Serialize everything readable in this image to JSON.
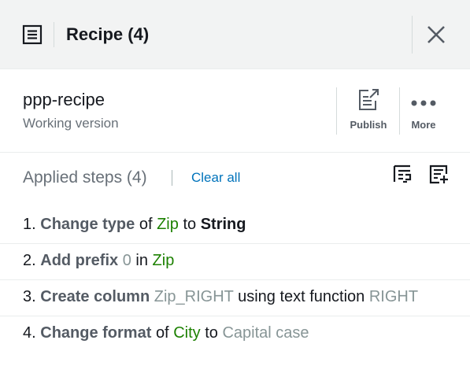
{
  "header": {
    "title": "Recipe (4)"
  },
  "recipe": {
    "name": "ppp-recipe",
    "status": "Working version"
  },
  "actions": {
    "publish_label": "Publish",
    "more_label": "More"
  },
  "steps_section": {
    "title": "Applied steps (4)",
    "clear_label": "Clear all"
  },
  "steps": [
    {
      "num": "1.",
      "action": "Change type",
      "p1": "of",
      "col": "Zip",
      "p2": "to",
      "val": "String"
    },
    {
      "num": "2.",
      "action": "Add prefix",
      "val": "0",
      "p1": "in",
      "col": "Zip"
    },
    {
      "num": "3.",
      "action": "Create column",
      "col": "Zip_RIGHT",
      "p1": "using text function",
      "val": "RIGHT"
    },
    {
      "num": "4.",
      "action": "Change format",
      "p1": "of",
      "col": "City",
      "p2": "to",
      "val": "Capital case"
    }
  ],
  "colors": {
    "accent": "#0073bb",
    "column": "#1d8102",
    "muted": "#687078"
  },
  "icons": [
    "list-icon",
    "close-icon",
    "publish-icon",
    "more-icon",
    "preview-steps-icon",
    "import-steps-icon"
  ]
}
